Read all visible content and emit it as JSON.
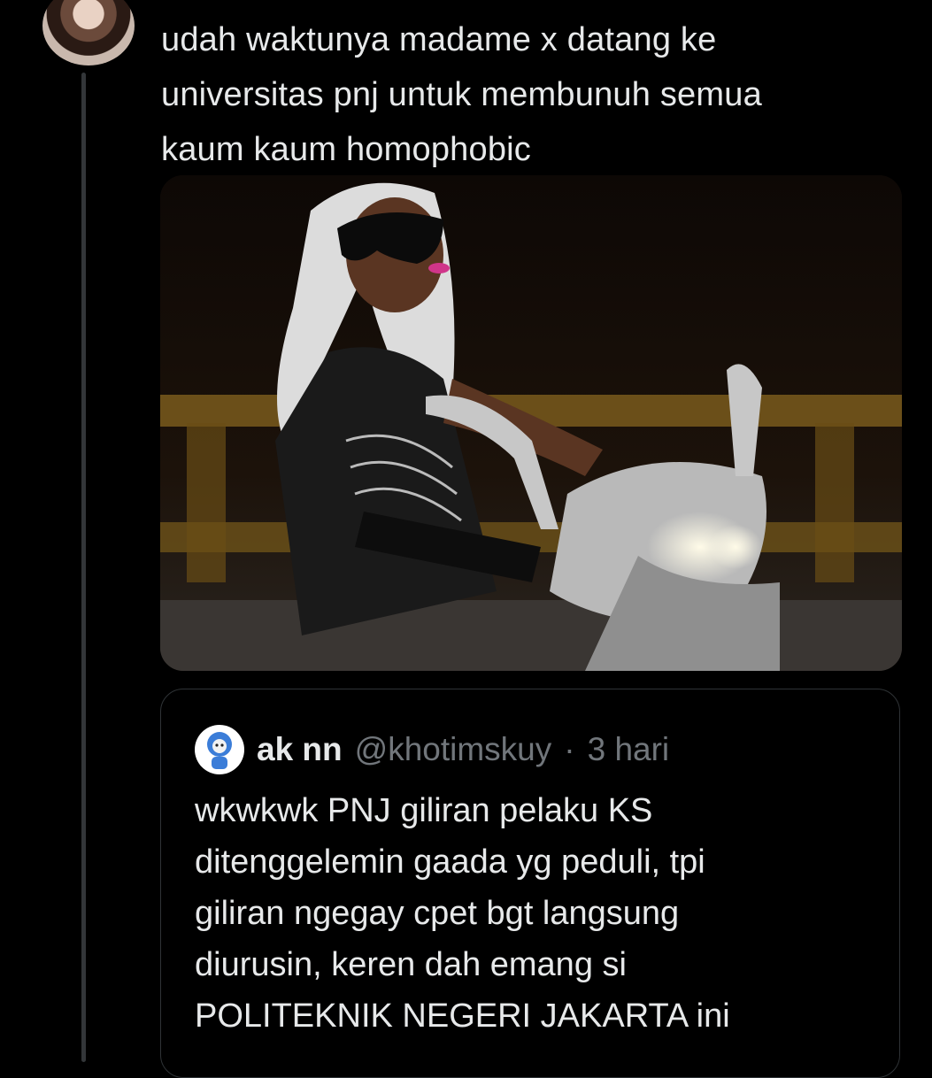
{
  "tweet": {
    "text": "udah waktunya madame x datang ke\nuniversitas pnj untuk membunuh semua\nkaum kaum homophobic"
  },
  "quoted_tweet": {
    "display_name": "ak nn",
    "handle": "@khotimskuy",
    "separator": "·",
    "time": "3 hari",
    "text": "wkwkwk PNJ giliran pelaku KS\nditenggelemin gaada yg peduli, tpi\ngiliran ngegay cpet bgt langsung\ndiurusin, keren dah emang si\nPOLITEKNIK NEGERI JAKARTA ini"
  },
  "colors": {
    "background": "#000000",
    "text": "#e7e9ea",
    "muted": "#71767b",
    "border": "#2f3336"
  }
}
